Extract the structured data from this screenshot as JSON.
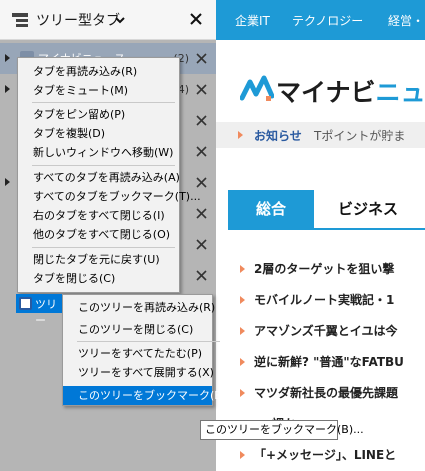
{
  "sidebar": {
    "title": "ツリー型タブ",
    "tabs": [
      {
        "label": "マイナビニュース",
        "count": "(2)"
      },
      {
        "label": "",
        "count": "(4)"
      },
      {
        "label": "",
        "count": ""
      },
      {
        "label": "",
        "count": ""
      },
      {
        "label": "",
        "count": ""
      },
      {
        "label": "",
        "count": ""
      },
      {
        "label": "",
        "count": ""
      },
      {
        "label": "",
        "count": ""
      }
    ],
    "selected_tree_label": "ツリー"
  },
  "context_menu": {
    "items": [
      "タブを再読み込み(R)",
      "タブをミュート(M)",
      "タブをピン留め(P)",
      "タブを複製(D)",
      "新しいウィンドウへ移動(W)",
      "すべてのタブを再読み込み(A)",
      "すべてのタブをブックマーク(T)...",
      "右のタブをすべて閉じる(I)",
      "他のタブをすべて閉じる(O)",
      "閉じたタブを元に戻す(U)",
      "タブを閉じる(C)"
    ]
  },
  "submenu": {
    "items": [
      "このツリーを再読み込み(R)",
      "このツリーを閉じる(C)",
      "ツリーをすべてたたむ(P)",
      "ツリーをすべて展開する(X)",
      "このツリーをブックマーク(B)..."
    ]
  },
  "tooltip": "このツリーをブックマーク(B)...",
  "page": {
    "nav": [
      "企業IT",
      "テクノロジー",
      "経営・"
    ],
    "logo_main": "マイナビ",
    "logo_suffix": "ニュ",
    "notice_label": "お知らせ",
    "notice_text": "Tポイントが貯ま",
    "tabs": [
      "総合",
      "ビジネス"
    ],
    "news": [
      "2層のターゲットを狙い撃",
      "モバイルノート実戦記・1",
      "アマゾンズ千翼とイユは今",
      "逆に新鮮? \"普通\"なFATBU",
      "マツダ新社長の最優先課題",
      "... 調か",
      "「+メッセージ」、LINEと"
    ]
  },
  "colors": {
    "accent": "#1e9ad6",
    "menu_highlight": "#0078d7",
    "bullet": "#f08a5d"
  }
}
